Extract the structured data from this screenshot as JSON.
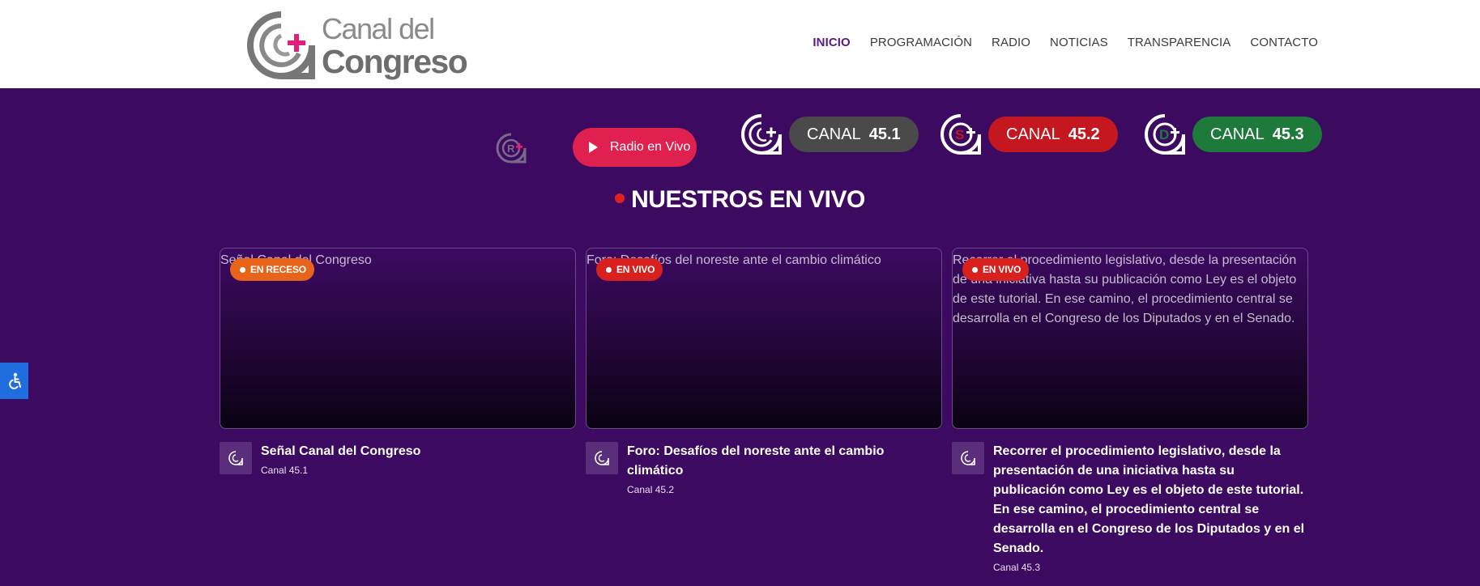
{
  "header": {
    "logo": {
      "line1": "Canal del",
      "line2": "Congreso"
    },
    "nav": [
      {
        "label": "INICIO",
        "active": true
      },
      {
        "label": "PROGRAMACIÓN"
      },
      {
        "label": "RADIO"
      },
      {
        "label": "NOTICIAS"
      },
      {
        "label": "TRANSPARENCIA"
      },
      {
        "label": "CONTACTO"
      }
    ]
  },
  "channel_bar": {
    "radio_button": "Radio en Vivo",
    "channels": [
      {
        "label": "CANAL",
        "number": "45.1",
        "color": "#4a4a4a",
        "icon": "canal-congreso-logo-icon"
      },
      {
        "label": "CANAL",
        "number": "45.2",
        "color": "#c4171f",
        "icon": "canal-senado-logo-icon"
      },
      {
        "label": "CANAL",
        "number": "45.3",
        "color": "#1e7a3a",
        "icon": "canal-diputados-logo-icon"
      }
    ]
  },
  "section_title": "NUESTROS EN VIVO",
  "cards": [
    {
      "thumb_alt": "Señal Canal del Congreso",
      "status": "EN RECESO",
      "status_color": "#e8641a",
      "title": "Señal Canal del Congreso",
      "channel": "Canal 45.1"
    },
    {
      "thumb_alt": "Foro: Desafíos del noreste ante el cambio climático",
      "status": "EN VIVO",
      "status_color": "#d8201f",
      "title": "Foro: Desafíos del noreste ante el cambio climático",
      "channel": "Canal 45.2"
    },
    {
      "thumb_alt": "Recorrer el procedimiento legislativo, desde la presentación de una iniciativa hasta su publicación como Ley es el objeto de este tutorial. En ese camino, el procedimiento central se desarrolla en el Congreso de los Diputados y en el Senado.",
      "status": "EN VIVO",
      "status_color": "#d8201f",
      "title": "Recorrer el procedimiento legislativo, desde la presentación de una iniciativa hasta su publicación como Ley es el objeto de este tutorial. En ese camino, el procedimiento central se desarrolla en el Congreso de los Diputados y en el Senado.",
      "channel": "Canal 45.3"
    }
  ],
  "colors": {
    "background": "#3d0a62",
    "accent_pink": "#e0204f",
    "accessibility_button": "#1f6ee0"
  }
}
